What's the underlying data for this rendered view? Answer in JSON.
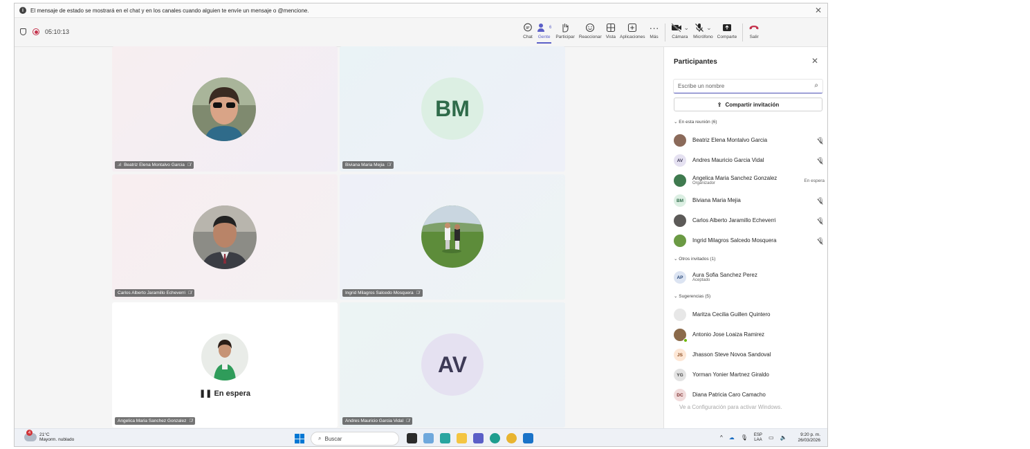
{
  "banner": {
    "text": "El mensaje de estado se mostrará en el chat y en los canales cuando alguien te envíe un mensaje o @mencione.",
    "close_icon": "close-icon"
  },
  "meeting": {
    "timer": "05:10:13"
  },
  "toolbar": {
    "chat": "Chat",
    "people": "Gente",
    "people_count": "6",
    "raise": "Participar",
    "react": "Reaccionar",
    "view": "Vista",
    "apps": "Aplicaciones",
    "more": "Más",
    "camera": "Cámara",
    "mic": "Micrófono",
    "share": "Comparte",
    "leave": "Salir"
  },
  "stage": {
    "tiles": [
      {
        "name": "Beatriz Elena Montalvo Garcia"
      },
      {
        "name": "Biviana Maria Mejia",
        "initials": "BM"
      },
      {
        "name": "Carlos Alberto Jaramillo Echeverri"
      },
      {
        "name": "Ingrid Milagros Salcedo Mosquera"
      },
      {
        "name": "Angelica Maria Sanchez Gonzalez",
        "status": "En espera"
      },
      {
        "name": "Andres Mauricio Garcia Vidal",
        "initials": "AV"
      }
    ]
  },
  "panel": {
    "title": "Participantes",
    "search_placeholder": "Escribe un nombre",
    "share_invite": "Compartir invitación",
    "section_in_meeting": "En esta reunión (6)",
    "in_meeting": [
      {
        "name": "Beatriz Elena Montalvo Garcia"
      },
      {
        "initials": "AV",
        "name": "Andres Mauricio Garcia Vidal"
      },
      {
        "name": "Angelica Maria Sanchez Gonzalez",
        "role": "Organizador",
        "status": "En espera"
      },
      {
        "initials": "BM",
        "name": "Biviana Maria Mejia"
      },
      {
        "name": "Carlos Alberto Jaramillo Echeverri"
      },
      {
        "name": "Ingrid Milagros Salcedo Mosquera"
      }
    ],
    "section_others": "Otros invitados (1)",
    "others": [
      {
        "initials": "AP",
        "name": "Aura Sofia Sanchez Perez",
        "status": "Aceptado"
      }
    ],
    "section_suggestions": "Sugerencias (5)",
    "suggestions": [
      {
        "name": "Maritza Cecilia Guillen Quintero"
      },
      {
        "name": "Antonio Jose Loaiza Ramirez"
      },
      {
        "initials": "JS",
        "name": "Jhasson Steve Novoa Sandoval"
      },
      {
        "initials": "YG",
        "name": "Yorman Yonier Martnez Giraldo"
      },
      {
        "initials": "DC",
        "name": "Diana Patricia Caro Camacho"
      }
    ],
    "watermark": "Ve a Configuración para activar Windows."
  },
  "taskbar": {
    "temp": "21°C",
    "weather": "Mayorm. nublado",
    "weather_badge": "4",
    "search": "Buscar",
    "lang_top": "ESP",
    "lang_bottom": "LAA",
    "time": "9:20 p. m.",
    "date": "26/03/2026"
  },
  "colors": {
    "accent": "#5b5fc7",
    "record": "#c4314b",
    "leave": "#c4314b"
  }
}
